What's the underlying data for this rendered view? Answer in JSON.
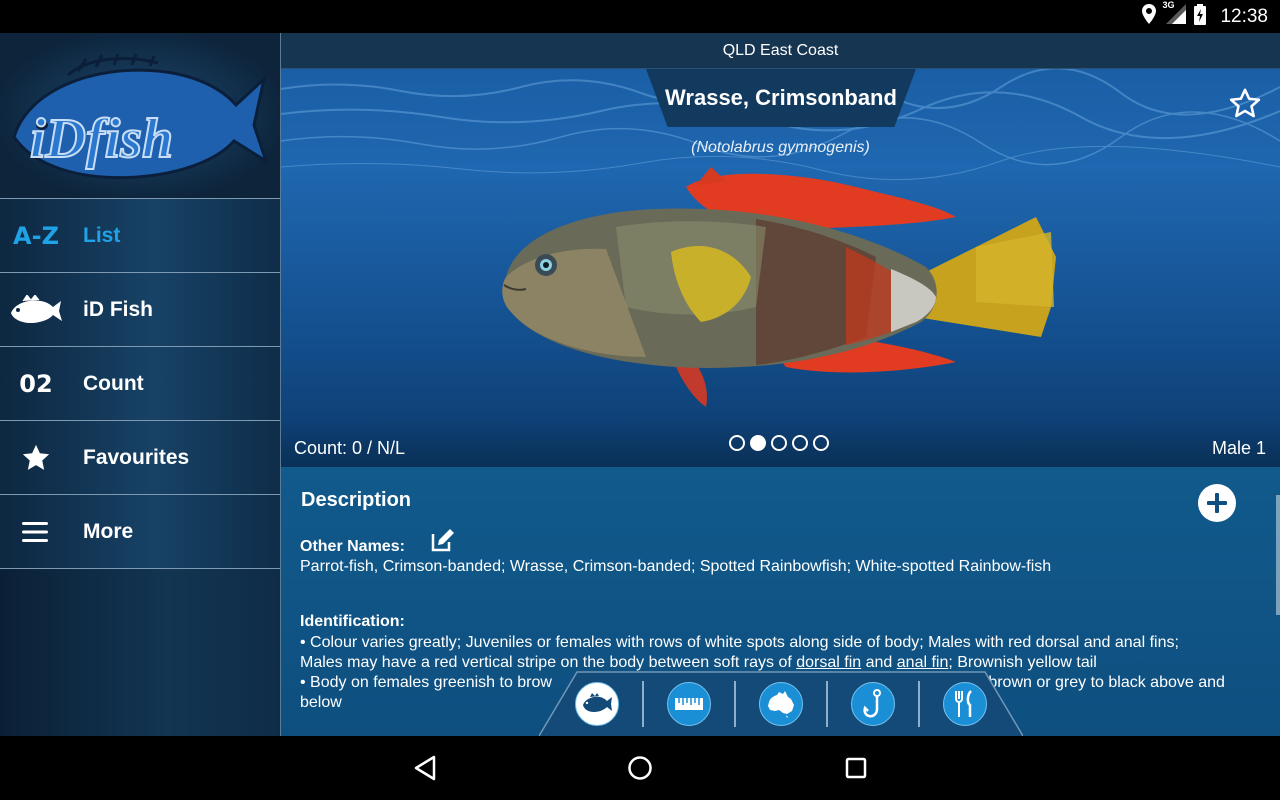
{
  "status_bar": {
    "time": "12:38",
    "network": "3G",
    "icons": [
      "location-icon",
      "signal-icon",
      "battery-icon"
    ]
  },
  "sidebar": {
    "logo_text": "iDfish",
    "items": [
      {
        "icon_text": "A-Z",
        "label": "List",
        "active": true
      },
      {
        "icon": "fish-icon",
        "label": "iD Fish",
        "active": false
      },
      {
        "icon_text": "02",
        "label": "Count",
        "active": false
      },
      {
        "icon": "star-icon",
        "label": "Favourites",
        "active": false
      },
      {
        "icon": "menu-icon",
        "label": "More",
        "active": false
      }
    ]
  },
  "main": {
    "region": "QLD East Coast",
    "fish": {
      "common_name": "Wrasse, Crimsonband",
      "scientific_name": "(Notolabrus gymnogenis)"
    },
    "count_text": "Count: 0 / N/L",
    "gender_text": "Male 1",
    "pager": {
      "total": 5,
      "active_index": 1
    },
    "description": {
      "title": "Description",
      "other_names_label": "Other Names:",
      "other_names": "Parrot-fish, Crimson-banded; Wrasse, Crimson-banded; Spotted Rainbowfish; White-spotted Rainbow-fish",
      "identification_label": "Identification:",
      "ident_line1": "• Colour varies greatly; Juveniles or females with rows of white spots along side of body; Males with red dorsal and anal fins;",
      "ident_line2_pre": "Males may have a red vertical stripe on the body between soft rays of ",
      "ident_link1": "dorsal fin",
      "ident_line2_mid": " and ",
      "ident_link2": "anal fin",
      "ident_line2_post": "; Brownish yellow tail",
      "ident_line3_pre": "• Body on females greenish to brow",
      "ident_line3_post": "sh brown or grey to black above and",
      "ident_line4": "below"
    },
    "dock": [
      {
        "icon": "fish-silhouette-icon",
        "active": true
      },
      {
        "icon": "ruler-icon",
        "active": false
      },
      {
        "icon": "australia-map-icon",
        "active": false
      },
      {
        "icon": "fish-hook-icon",
        "active": false
      },
      {
        "icon": "fork-knife-icon",
        "active": false
      }
    ]
  },
  "colors": {
    "active_nav": "#1fa3e8",
    "accent_blue": "#1b8fd6",
    "panel_blue": "#115a8c"
  }
}
